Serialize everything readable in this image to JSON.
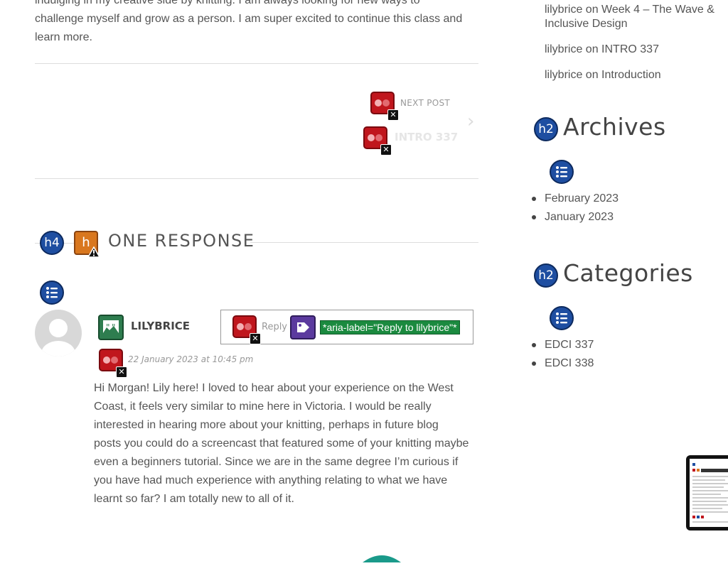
{
  "post": {
    "intro_line1": "indulging in my creative side by knitting. I am always looking for new ways to",
    "intro_line2": "challenge myself and grow as a person. I am super excited to continue this class and",
    "intro_line3": "learn more."
  },
  "post_nav": {
    "next_label": "NEXT POST",
    "next_title": "INTRO 337"
  },
  "comments": {
    "heading_badge": "h4",
    "heading": "ONE RESPONSE",
    "author": "LILYBRICE",
    "reply_label": "Reply",
    "aria_label": "*aria-label=\"Reply to lilybrice\"*",
    "date": "22 January 2023 at 10:45 pm",
    "body_lines": [
      "Hi Morgan! Lily here! I loved to hear about your experience on the West",
      "Coast, it feels very similar to mine here in Victoria. I would be really",
      "interested in hearing more about your knitting, perhaps in future blog",
      "posts you could do a screencast that featured some of your knitting maybe",
      "even a beginners tutorial. Since we are in the same degree I’m curious if",
      "you have had much experience with anything relating to what we have",
      "learnt so far? I am totally new to all of it."
    ]
  },
  "sidebar": {
    "recent_comments": [
      {
        "author": "lilybrice",
        "on": "on",
        "title_line1": "Week 4 – The Wave &",
        "title_line2": "Inclusive Design"
      },
      {
        "author": "lilybrice",
        "on": "on",
        "title_line1": "INTRO 337"
      },
      {
        "author": "lilybrice",
        "on": "on",
        "title_line1": "Introduction"
      }
    ],
    "archives_badge": "h2",
    "archives_title": "Archives",
    "archives": [
      "February 2023",
      "January 2023"
    ],
    "categories_badge": "h2",
    "categories_title": "Categories",
    "categories": [
      "EDCI 337",
      "EDCI 338"
    ]
  },
  "colors": {
    "heading_badge_blue": "#1e4ea1",
    "error_red": "#c0161d",
    "aria_green": "#1b8a3f",
    "tag_purple": "#5b3a9e",
    "alert_orange": "#d9771e"
  }
}
